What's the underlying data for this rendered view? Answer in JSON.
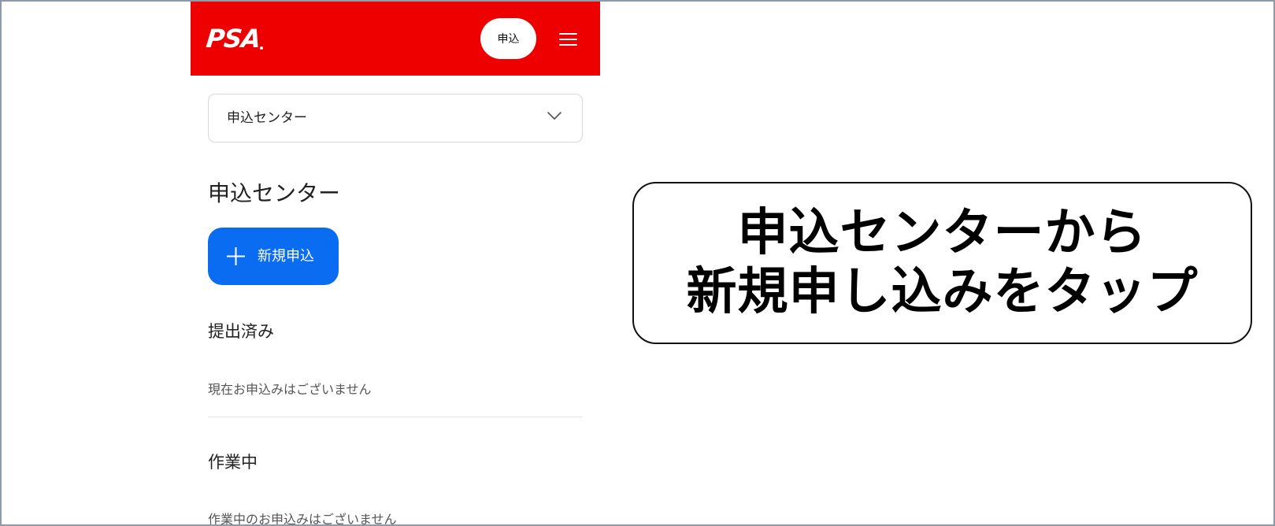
{
  "header": {
    "logo_text": "PSA",
    "apply_button_label": "申込",
    "menu_icon": "hamburger-menu-icon",
    "brand_color": "#ee0000"
  },
  "nav_select": {
    "selected_value": "申込センター",
    "icon": "chevron-down-icon"
  },
  "page": {
    "title": "申込センター",
    "new_application_button": {
      "label": "新規申込",
      "icon": "plus-icon",
      "color": "#0a6cf0"
    },
    "sections": [
      {
        "heading": "提出済み",
        "empty_message": "現在お申込みはございません"
      },
      {
        "heading": "作業中",
        "empty_message": "作業中のお申込みはございません"
      }
    ]
  },
  "callout": {
    "lines": [
      "申込センターから",
      "新規申し込みをタップ"
    ]
  }
}
